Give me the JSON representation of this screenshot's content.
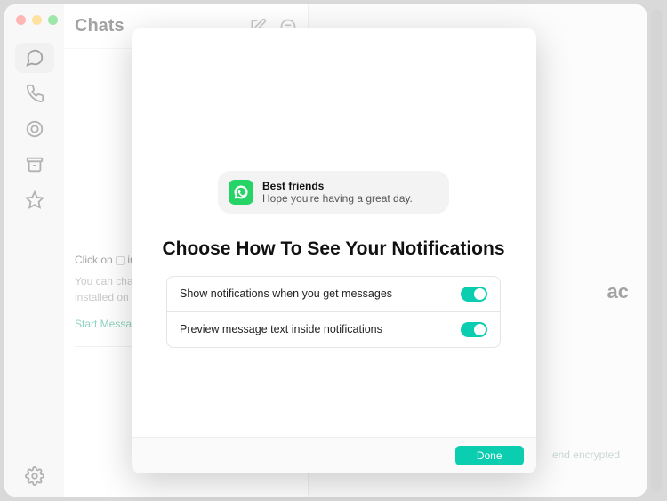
{
  "header": {
    "title": "Chats"
  },
  "sidebar_hints": {
    "click_on": "Click on",
    "in_the": "in t",
    "body": "You can chat w",
    "body2": "installed on th",
    "start": "Start Messagin"
  },
  "main_bg": {
    "title_fragment": "ac",
    "encrypted": "end encrypted"
  },
  "modal": {
    "notification": {
      "title": "Best friends",
      "subtitle": "Hope you're having a great day."
    },
    "title": "Choose How To See Your Notifications",
    "settings": [
      {
        "label": "Show notifications when you get messages",
        "on": true
      },
      {
        "label": "Preview message text inside notifications",
        "on": true
      }
    ],
    "done": "Done"
  }
}
